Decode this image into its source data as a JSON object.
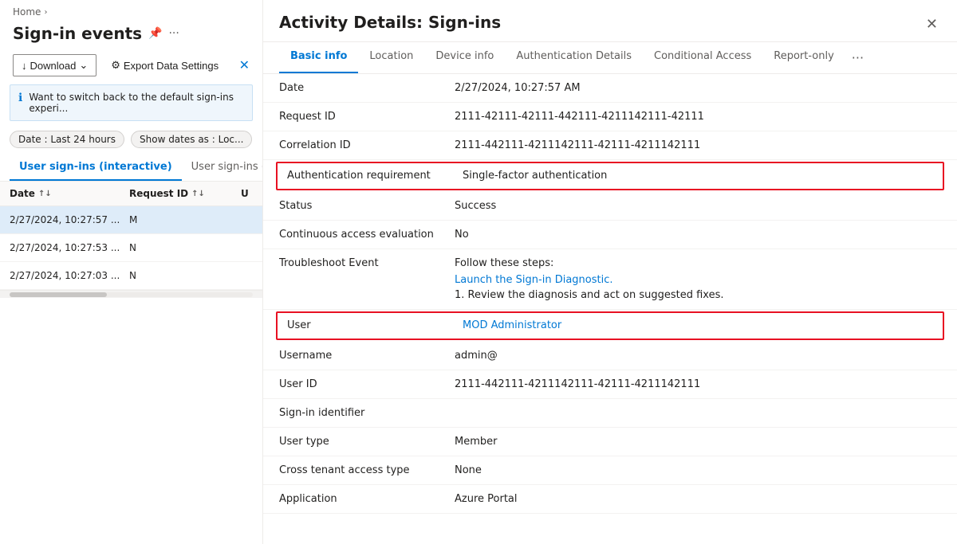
{
  "breadcrumb": {
    "home": "Home",
    "chevron": "›"
  },
  "leftPanel": {
    "title": "Sign-in events",
    "toolbar": {
      "download_label": "Download",
      "export_label": "Export Data Settings",
      "close_symbol": "✕"
    },
    "infoBanner": {
      "text": "Want to switch back to the default sign-ins experi..."
    },
    "filterBar": {
      "date_pill": "Date : Last 24 hours",
      "show_dates": "Show dates as : Loc..."
    },
    "tabs": [
      {
        "label": "User sign-ins (interactive)",
        "active": true
      },
      {
        "label": "User sign-ins (non...",
        "active": false
      }
    ],
    "tableHeaders": {
      "date": "Date",
      "requestId": "Request ID",
      "u": "U"
    },
    "rows": [
      {
        "date": "2/27/2024, 10:27:57 ...",
        "requestId": "M",
        "selected": true
      },
      {
        "date": "2/27/2024, 10:27:53 ...",
        "requestId": "N",
        "selected": false
      },
      {
        "date": "2/27/2024, 10:27:03 ...",
        "requestId": "N",
        "selected": false
      }
    ]
  },
  "rightPanel": {
    "title": "Activity Details: Sign-ins",
    "tabs": [
      {
        "label": "Basic info",
        "active": true
      },
      {
        "label": "Location",
        "active": false
      },
      {
        "label": "Device info",
        "active": false
      },
      {
        "label": "Authentication Details",
        "active": false
      },
      {
        "label": "Conditional Access",
        "active": false
      },
      {
        "label": "Report-only",
        "active": false
      }
    ],
    "fields": [
      {
        "label": "Date",
        "value": "2/27/2024, 10:27:57 AM",
        "highlight": false,
        "type": "text"
      },
      {
        "label": "Request ID",
        "value": "2111-42111-42111-442111-4211142111-42111",
        "highlight": false,
        "type": "text"
      },
      {
        "label": "Correlation ID",
        "value": "2111-442111-4211142111-42111-4211142111",
        "highlight": false,
        "type": "text"
      },
      {
        "label": "Authentication requirement",
        "value": "Single-factor authentication",
        "highlight": true,
        "type": "text"
      },
      {
        "label": "Status",
        "value": "Success",
        "highlight": false,
        "type": "text"
      },
      {
        "label": "Continuous access evaluation",
        "value": "No",
        "highlight": false,
        "type": "text"
      },
      {
        "label": "Troubleshoot Event",
        "highlight": false,
        "type": "troubleshoot",
        "follow_text": "Follow these steps:",
        "link_text": "Launch the Sign-in Diagnostic.",
        "step_text": "1. Review the diagnosis and act on suggested fixes."
      },
      {
        "label": "User",
        "value": "MOD Administrator",
        "highlight": true,
        "type": "link"
      },
      {
        "label": "Username",
        "value": "admin@",
        "highlight": false,
        "type": "text"
      },
      {
        "label": "User ID",
        "value": "2111-442111-4211142111-42111-4211142111",
        "highlight": false,
        "type": "text"
      },
      {
        "label": "Sign-in identifier",
        "value": "",
        "highlight": false,
        "type": "text"
      },
      {
        "label": "User type",
        "value": "Member",
        "highlight": false,
        "type": "text"
      },
      {
        "label": "Cross tenant access type",
        "value": "None",
        "highlight": false,
        "type": "text"
      },
      {
        "label": "Application",
        "value": "Azure Portal",
        "highlight": false,
        "type": "text"
      }
    ]
  }
}
